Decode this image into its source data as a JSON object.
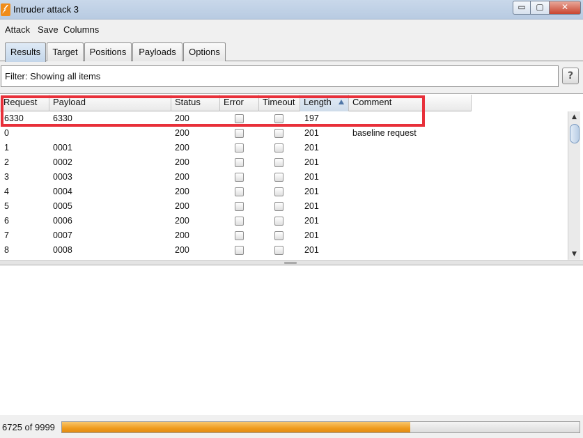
{
  "window": {
    "title": "Intruder attack 3",
    "controls": {
      "minimize": "▭",
      "maximize": "▢",
      "close": "✕"
    }
  },
  "menu": [
    "Attack",
    "Save",
    "Columns"
  ],
  "tabs": [
    "Results",
    "Target",
    "Positions",
    "Payloads",
    "Options"
  ],
  "active_tab": "Results",
  "filter": {
    "text": "Filter: Showing all items",
    "help_label": "?"
  },
  "table": {
    "columns": [
      "Request",
      "Payload",
      "Status",
      "Error",
      "Timeout",
      "Length",
      "Comment"
    ],
    "sorted_column": "Length",
    "rows": [
      {
        "request": "6330",
        "payload": "6330",
        "status": "200",
        "error": false,
        "timeout": false,
        "length": "197",
        "comment": ""
      },
      {
        "request": "0",
        "payload": "",
        "status": "200",
        "error": false,
        "timeout": false,
        "length": "201",
        "comment": "baseline request"
      },
      {
        "request": "1",
        "payload": "0001",
        "status": "200",
        "error": false,
        "timeout": false,
        "length": "201",
        "comment": ""
      },
      {
        "request": "2",
        "payload": "0002",
        "status": "200",
        "error": false,
        "timeout": false,
        "length": "201",
        "comment": ""
      },
      {
        "request": "3",
        "payload": "0003",
        "status": "200",
        "error": false,
        "timeout": false,
        "length": "201",
        "comment": ""
      },
      {
        "request": "4",
        "payload": "0004",
        "status": "200",
        "error": false,
        "timeout": false,
        "length": "201",
        "comment": ""
      },
      {
        "request": "5",
        "payload": "0005",
        "status": "200",
        "error": false,
        "timeout": false,
        "length": "201",
        "comment": ""
      },
      {
        "request": "6",
        "payload": "0006",
        "status": "200",
        "error": false,
        "timeout": false,
        "length": "201",
        "comment": ""
      },
      {
        "request": "7",
        "payload": "0007",
        "status": "200",
        "error": false,
        "timeout": false,
        "length": "201",
        "comment": ""
      },
      {
        "request": "8",
        "payload": "0008",
        "status": "200",
        "error": false,
        "timeout": false,
        "length": "201",
        "comment": ""
      }
    ]
  },
  "progress": {
    "text": "6725 of 9999",
    "done": 6725,
    "total": 9999
  },
  "colors": {
    "highlight_border": "#e8303a",
    "progress_fill": "#ef9b1d",
    "active_tab": "#c4d6ea"
  },
  "icons": {
    "app": "burp-lightning-icon",
    "help": "question-icon",
    "scroll_up": "▲",
    "scroll_down": "▼"
  }
}
